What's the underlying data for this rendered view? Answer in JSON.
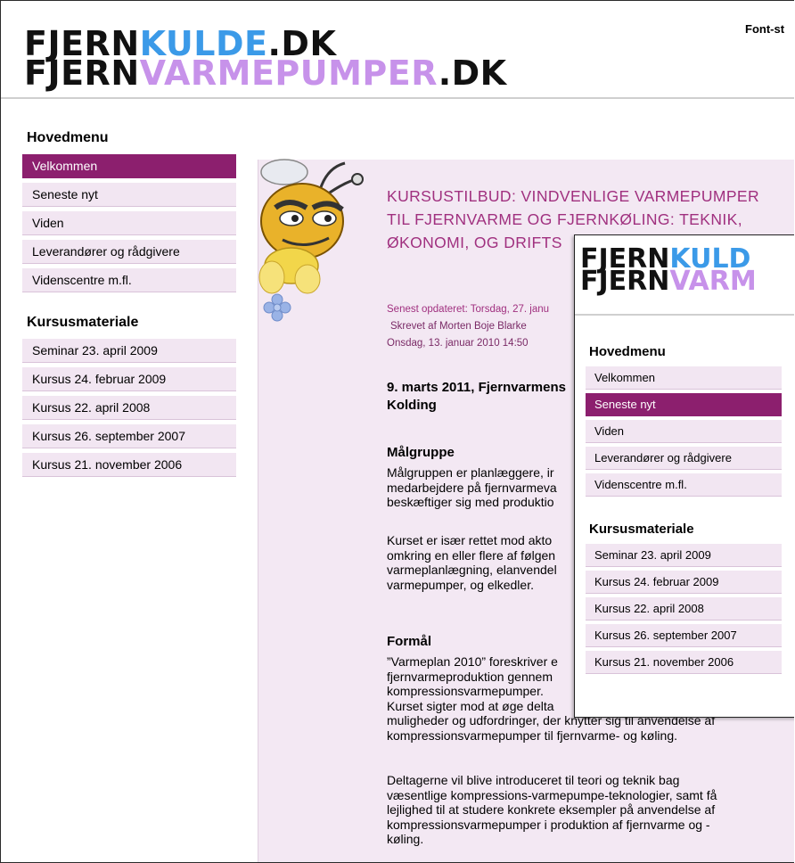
{
  "header": {
    "logo_line1_a": "FJERN",
    "logo_line1_b": "KULDE",
    "logo_line1_c": ".DK",
    "logo_line2_a": "FJERN",
    "logo_line2_b": "VARMEPUMPER",
    "logo_line2_c": ".DK",
    "font_size_label": "Font-st"
  },
  "sidebar": {
    "main_heading": "Hovedmenu",
    "main_items": [
      {
        "label": "Velkommen",
        "active": true
      },
      {
        "label": "Seneste nyt"
      },
      {
        "label": "Viden"
      },
      {
        "label": "Leverandører og rådgivere"
      },
      {
        "label": "Videnscentre m.fl."
      }
    ],
    "course_heading": "Kursusmateriale",
    "course_items": [
      {
        "label": "Seminar 23. april 2009"
      },
      {
        "label": "Kursus 24. februar 2009"
      },
      {
        "label": "Kursus 22. april 2008"
      },
      {
        "label": "Kursus 26. september 2007"
      },
      {
        "label": "Kursus 21. november 2006"
      }
    ]
  },
  "article": {
    "title_lines": [
      "KURSUSTILBUD: VINDVENLIGE VARMEPUMPER",
      "TIL FJERNVARME OG FJERNKØLING: TEKNIK,",
      "ØKONOMI, OG DRIFTS"
    ],
    "updated": "Senest opdateret: Torsdag, 27. janu",
    "author": "Skrevet af Morten Boje Blarke",
    "date": "Onsdag, 13. januar 2010 14:50",
    "lead_lines": [
      "9. marts 2011, Fjernvarmens",
      "Kolding"
    ],
    "h_malgruppe": "Målgruppe",
    "p1_lines": [
      "Målgruppen er planlæggere, ir",
      "medarbejdere på fjernvarmeva",
      "beskæftiger sig med produktio"
    ],
    "p2_lines": [
      "Kurset er især rettet mod akto",
      "omkring en eller flere af følgen",
      "varmeplanlægning, elanvendel",
      "varmepumper, og elkedler."
    ],
    "h_formal": "Formål",
    "p3_lines": [
      "”Varmeplan 2010” foreskriver e",
      "fjernvarmeproduktion gennem",
      "kompressionsvarmepumper.",
      "Kurset sigter mod at øge delta",
      "muligheder og udfordringer, der knytter sig til anvendelse af",
      "kompressionsvarmepumper til fjernvarme- og køling."
    ],
    "p4_lines": [
      "Deltagerne vil blive introduceret til teori og teknik bag",
      "væsentlige kompressions-varmepumpe-teknologier, samt få",
      "lejlighed til at studere konkrete eksempler på anvendelse af",
      "kompressionsvarmepumper i produktion af fjernvarme og -",
      "køling."
    ]
  },
  "popup": {
    "logo_line1_a": "FJERN",
    "logo_line1_b": "KULD",
    "logo_line2_a": "FJERN",
    "logo_line2_b": "VARM",
    "main_heading": "Hovedmenu",
    "main_items": [
      {
        "label": "Velkommen"
      },
      {
        "label": "Seneste nyt",
        "active": true
      },
      {
        "label": "Viden"
      },
      {
        "label": "Leverandører og rådgivere"
      },
      {
        "label": "Videnscentre m.fl."
      }
    ],
    "course_heading": "Kursusmateriale",
    "course_items": [
      {
        "label": "Seminar 23. april 2009"
      },
      {
        "label": "Kursus 24. februar 2009"
      },
      {
        "label": "Kursus 22. april 2008"
      },
      {
        "label": "Kursus 26. september 2007"
      },
      {
        "label": "Kursus 21. november 2006"
      }
    ]
  },
  "colors": {
    "accent_purple": "#8c1f6e",
    "title_magenta": "#a0307f",
    "logo_blue": "#3b9ae8",
    "logo_lavender": "#c792ea",
    "menu_bg": "#f2e6f2",
    "content_bg": "#f3e8f3"
  }
}
